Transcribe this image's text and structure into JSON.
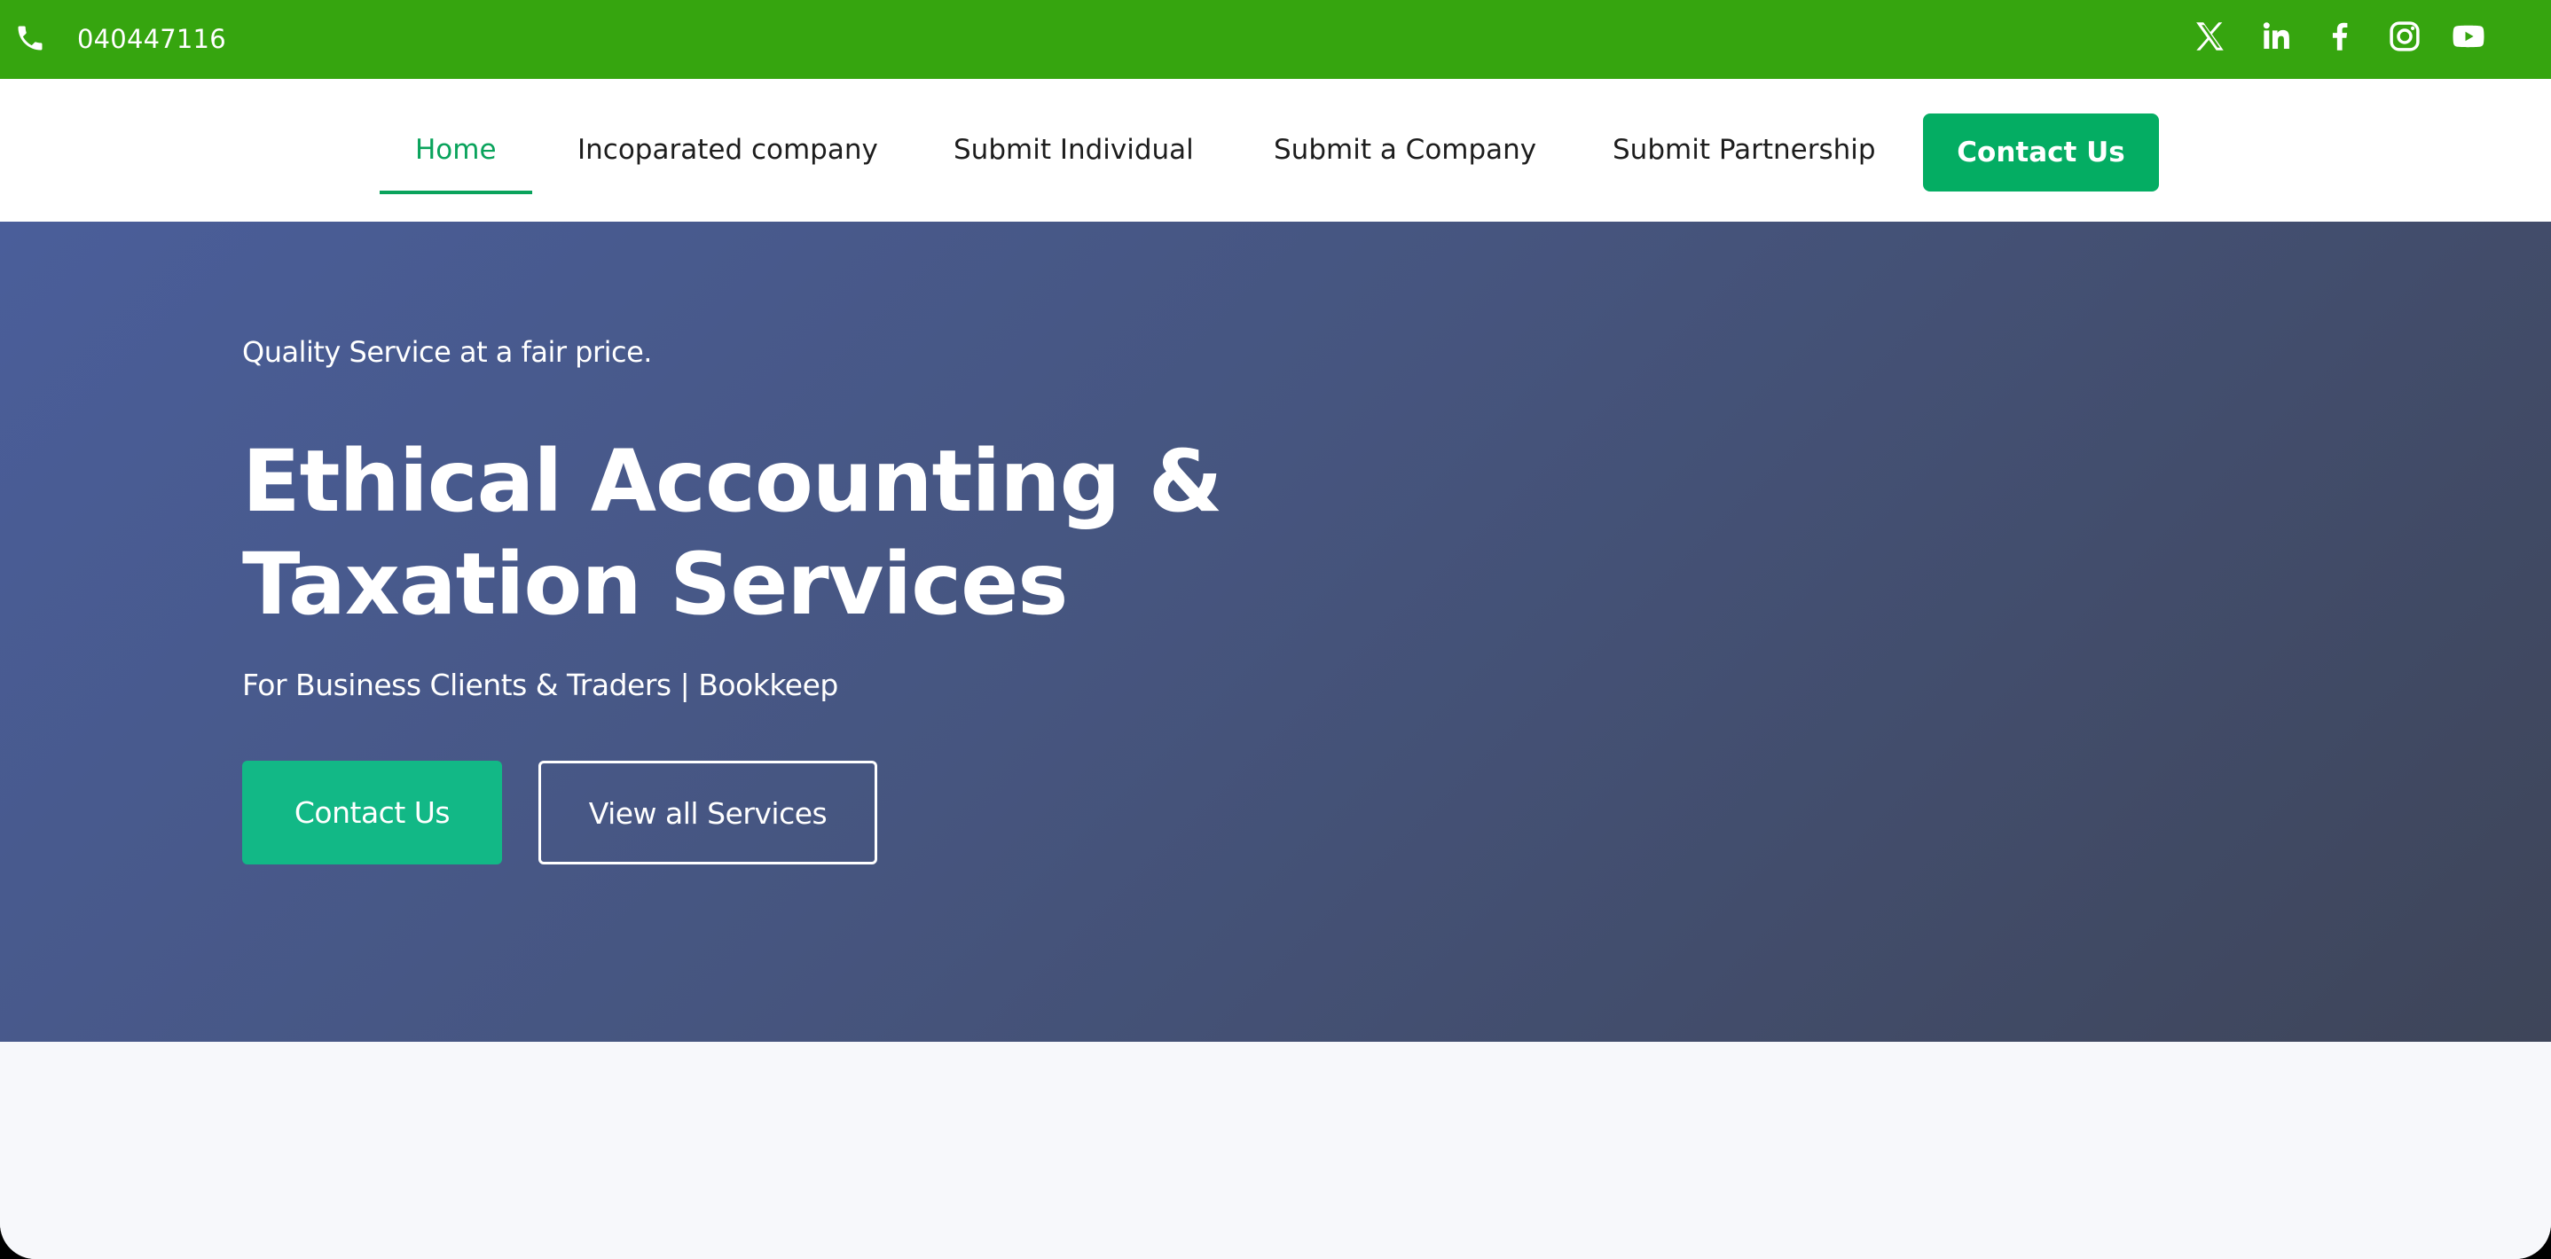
{
  "topbar": {
    "phone_icon": "phone-icon",
    "phone_number": "040447116",
    "background_color": "#36a50f",
    "social_links": [
      {
        "name": "x-icon",
        "label": "X"
      },
      {
        "name": "linkedin-icon",
        "label": "LinkedIn"
      },
      {
        "name": "facebook-icon",
        "label": "Facebook"
      },
      {
        "name": "instagram-icon",
        "label": "Instagram"
      },
      {
        "name": "youtube-icon",
        "label": "YouTube"
      }
    ]
  },
  "nav": {
    "items": [
      {
        "label": "Home",
        "active": true
      },
      {
        "label": "Incoparated company",
        "active": false
      },
      {
        "label": "Submit Individual",
        "active": false
      },
      {
        "label": "Submit a Company",
        "active": false
      },
      {
        "label": "Submit Partnership",
        "active": false
      }
    ],
    "cta_label": "Contact Us",
    "accent_color": "#0aa35c"
  },
  "hero": {
    "tagline": "Quality Service at a fair price.",
    "title_line1": "Ethical Accounting &",
    "title_line2": "Taxation Services",
    "subtitle": "For Business Clients & Traders | Bookkeep",
    "primary_button": "Contact Us",
    "secondary_button": "View all Services",
    "primary_button_color": "#12b886"
  }
}
